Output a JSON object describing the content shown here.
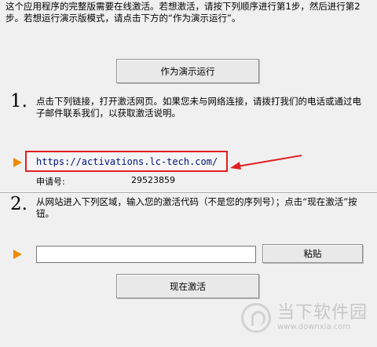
{
  "intro_text": "这个应用程序的完整版需要在线激活。若想激活，请按下列顺序进行第1步，然后进行第2步。若想运行演示版模式，请点击下方的“作为演示运行”。",
  "demo_button": "作为演示运行",
  "step1": {
    "number": "1.",
    "text": "点击下列链接，打开激活网页。如果您未与网络连接，请拨打我们的电话或通过电子邮件联系我们，以获取激活说明。",
    "link": "https://activations.lc-tech.com/",
    "request_label": "申请号:",
    "request_value": "29523859"
  },
  "step2": {
    "number": "2.",
    "text": "从网站进入下列区域，输入您的激活代码（不是您的序列号）；点击“现在激活”按钮。",
    "code_value": "",
    "paste_button": "粘贴",
    "activate_button": "现在激活"
  },
  "watermark": {
    "title": "当下软件园",
    "url": "www.downxia.com"
  },
  "colors": {
    "accent_arrow": "#f08a00",
    "highlight": "#e02020",
    "link": "#00137e"
  }
}
